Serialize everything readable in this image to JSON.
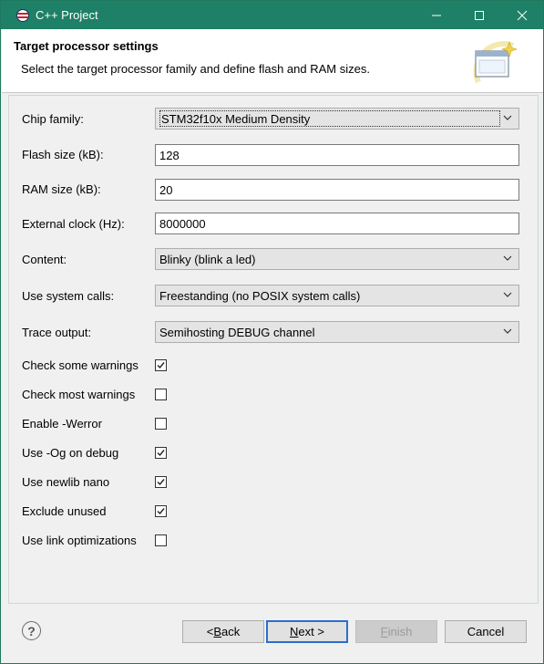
{
  "window": {
    "title": "C++ Project",
    "minimize_glyph": "—",
    "maximize_glyph": "☐",
    "close_glyph": "✕"
  },
  "header": {
    "title": "Target processor settings",
    "description": "Select the target processor family and define flash and RAM sizes."
  },
  "form": {
    "chip_family": {
      "label": "Chip family:",
      "value": "STM32f10x Medium Density"
    },
    "flash_size": {
      "label": "Flash size (kB):",
      "value": "128"
    },
    "ram_size": {
      "label": "RAM size (kB):",
      "value": "20"
    },
    "external_clock": {
      "label": "External clock (Hz):",
      "value": "8000000"
    },
    "content": {
      "label": "Content:",
      "value": "Blinky (blink a led)"
    },
    "system_calls": {
      "label": "Use system calls:",
      "value": "Freestanding (no POSIX system calls)"
    },
    "trace_output": {
      "label": "Trace output:",
      "value": "Semihosting DEBUG channel"
    }
  },
  "options": [
    {
      "label": "Check some warnings",
      "checked": true
    },
    {
      "label": "Check most warnings",
      "checked": false
    },
    {
      "label": "Enable -Werror",
      "checked": false
    },
    {
      "label": "Use -Og on debug",
      "checked": true
    },
    {
      "label": "Use newlib nano",
      "checked": true
    },
    {
      "label": "Exclude unused",
      "checked": true
    },
    {
      "label": "Use link optimizations",
      "checked": false
    }
  ],
  "buttons": {
    "help": "?",
    "back_mnemonic": "< ",
    "back_underlined": "B",
    "back_rest": "ack",
    "next_underlined": "N",
    "next_rest": "ext >",
    "finish_underlined": "F",
    "finish_rest": "inish",
    "cancel": "Cancel"
  },
  "colors": {
    "titlebar": "#1e8066",
    "default_button_border": "#2a6fd0"
  }
}
